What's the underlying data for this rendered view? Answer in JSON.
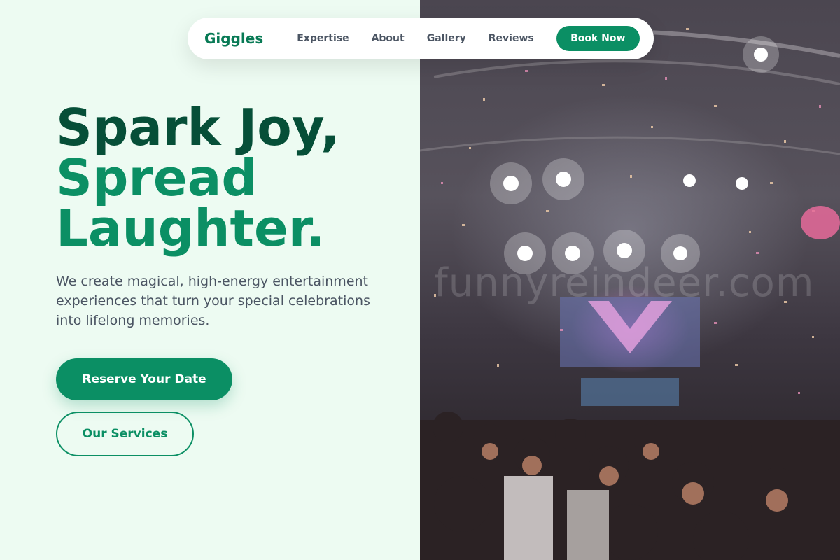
{
  "nav": {
    "brand": "Giggles",
    "links": [
      "Expertise",
      "About",
      "Gallery",
      "Reviews"
    ],
    "cta": "Book Now"
  },
  "hero": {
    "headline_line1": "Spark Joy,",
    "headline_line2": "Spread",
    "headline_line3": "Laughter.",
    "lead": "We create magical, high-energy entertainment experiences that turn your special celebrations into lifelong memories.",
    "primary_button": "Reserve Your Date",
    "secondary_button": "Our Services"
  },
  "image": {
    "description_icon": "concert-crowd-photo",
    "watermark": "funnyreindeer.com"
  },
  "colors": {
    "brand_green": "#0b8f64",
    "dark_green": "#064f38",
    "background": "#edfbf2"
  }
}
